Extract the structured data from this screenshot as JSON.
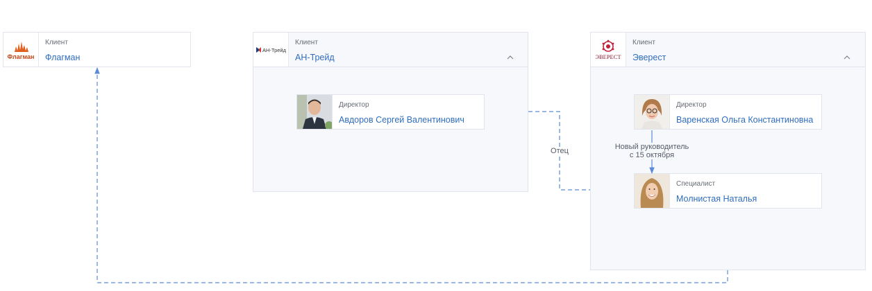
{
  "colors": {
    "link": "#2f6dbf",
    "edge": "#5b8ad6",
    "group_bg": "#f7f8fc",
    "border": "#e1e4ec",
    "logo_flagman": "#e0601f",
    "logo_everest": "#c0203a"
  },
  "clients": {
    "flagman": {
      "role": "Клиент",
      "name": "Флагман",
      "logo_text": "Флагман",
      "logo_icon": "flame-skyline-logo"
    },
    "an_trade": {
      "role": "Клиент",
      "name": "АН-Трейд",
      "logo_text": "АН-Трейд",
      "logo_icon": "arrows-logo"
    },
    "everest": {
      "role": "Клиент",
      "name": "Эверест",
      "logo_text": "ЭВЕРЕСТ",
      "logo_icon": "rosette-logo"
    }
  },
  "people": {
    "avdorov": {
      "role": "Директор",
      "name": "Авдоров Сергей Валентинович",
      "avatar": "man-photo"
    },
    "varenskaya": {
      "role": "Директор",
      "name": "Варенская Ольга Константиновна",
      "avatar": "woman-glasses-photo"
    },
    "molnistaya": {
      "role": "Специалист",
      "name": "Молнистая Наталья",
      "avatar": "woman-smiling-photo"
    }
  },
  "edges": {
    "new_manager": {
      "line1": "Новый руководитель",
      "line2": "с 15 октября"
    },
    "father": {
      "label": "Отец"
    }
  }
}
